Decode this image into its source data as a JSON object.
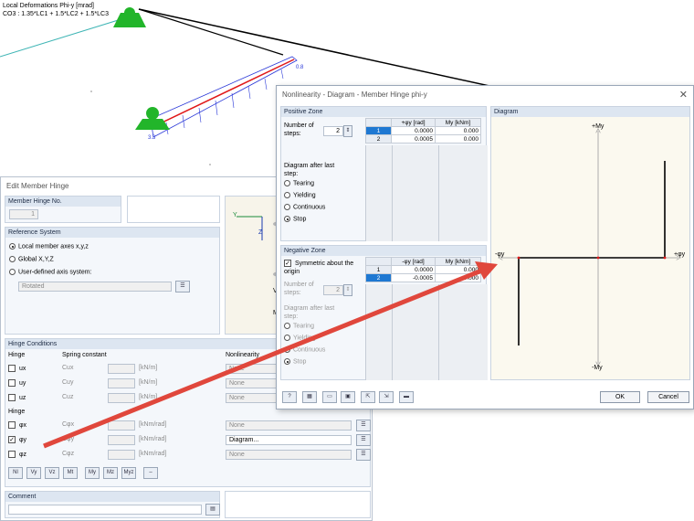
{
  "viewport": {
    "title": "Local Deformations Phi-y [mrad]",
    "combo": "CO3 : 1.35*LC1 + 1.5*LC2 + 1.5*LC3",
    "value_end": "0.8",
    "value_start": "3.3"
  },
  "edit_hinge": {
    "title": "Edit Member Hinge",
    "hinge_no_label": "Member Hinge No.",
    "hinge_no_value": "1",
    "ref_system": {
      "label": "Reference System",
      "local": "Local member axes x,y,z",
      "global": "Global X,Y,Z",
      "user": "User-defined axis system:",
      "user_value": "Rotated"
    },
    "preview": {
      "y": "Y",
      "z": "Z",
      "v": "V",
      "m": "M"
    },
    "conditions": {
      "label": "Hinge Conditions",
      "hinge_col": "Hinge",
      "spring_col": "Spring constant",
      "nonlinearity_col": "Nonlinearity",
      "hinge_col2": "Hinge",
      "rows_u": [
        {
          "sym": "ux",
          "c": "Cux",
          "unit": "[kN/m]",
          "nl": "None"
        },
        {
          "sym": "uy",
          "c": "Cuy",
          "unit": "[kN/m]",
          "nl": "None"
        },
        {
          "sym": "uz",
          "c": "Cuz",
          "unit": "[kN/m]",
          "nl": "None"
        }
      ],
      "rows_phi": [
        {
          "sym": "φx",
          "c": "Cφx",
          "unit": "[kNm/rad]",
          "nl": "None"
        },
        {
          "sym": "φy",
          "c": "Cφy",
          "unit": "[kNm/rad]",
          "nl": "Diagram..."
        },
        {
          "sym": "φz",
          "c": "Cφz",
          "unit": "[kNm/rad]",
          "nl": "None"
        }
      ]
    },
    "comment_label": "Comment"
  },
  "nl_dialog": {
    "title": "Nonlinearity - Diagram - Member Hinge phi-y",
    "positive": {
      "label": "Positive Zone",
      "steps_label": "Number of steps:",
      "steps": "2",
      "after_label": "Diagram after last step:",
      "options": [
        "Tearing",
        "Yielding",
        "Continuous",
        "Stop"
      ],
      "col1": "+φy [rad]",
      "col2": "My [kNm]",
      "rows": [
        {
          "n": "1",
          "phi": "0.0000",
          "m": "0.000"
        },
        {
          "n": "2",
          "phi": "0.0005",
          "m": "0.000"
        }
      ]
    },
    "negative": {
      "label": "Negative Zone",
      "symmetric": "Symmetric about the origin",
      "steps_label": "Number of steps:",
      "steps": "2",
      "after_label": "Diagram after last step:",
      "options": [
        "Tearing",
        "Yielding",
        "Continuous",
        "Stop"
      ],
      "col1": "-φy [rad]",
      "col2": "My [kNm]",
      "rows": [
        {
          "n": "1",
          "phi": "0.0000",
          "m": "0.000"
        },
        {
          "n": "2",
          "phi": "-0.0005",
          "m": "0.000"
        }
      ]
    },
    "diagram": {
      "label": "Diagram",
      "plus_m": "+My",
      "minus_m": "-My",
      "plus_phi": "+φy",
      "minus_phi": "-φy"
    },
    "ok": "OK",
    "cancel": "Cancel"
  },
  "colors": {
    "accent": "#1e78d2",
    "arrow": "#e0473c",
    "support": "#22b52a"
  }
}
